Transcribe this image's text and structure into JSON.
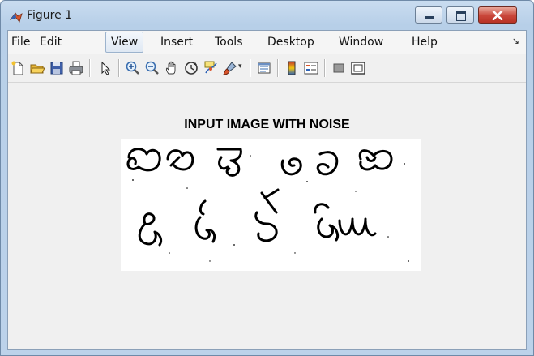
{
  "window": {
    "title": "Figure 1"
  },
  "menu": {
    "items": [
      "File",
      "Edit",
      "View",
      "Insert",
      "Tools",
      "Desktop",
      "Window",
      "Help"
    ],
    "active": "View"
  },
  "toolbar": {
    "buttons": [
      "new-figure-icon",
      "open-file-icon",
      "save-icon",
      "print-icon",
      "select-arrow-icon",
      "zoom-in-icon",
      "zoom-out-icon",
      "pan-hand-icon",
      "rotate-3d-icon",
      "data-cursor-icon",
      "brush-icon",
      "brush-dropdown-icon",
      "link-plot-icon",
      "colorbar-icon",
      "legend-icon",
      "hide-plot-tools-icon",
      "show-plot-tools-icon"
    ]
  },
  "figure": {
    "title": "INPUT IMAGE WITH NOISE",
    "image_content": "handwritten Telugu characters, two rows"
  }
}
